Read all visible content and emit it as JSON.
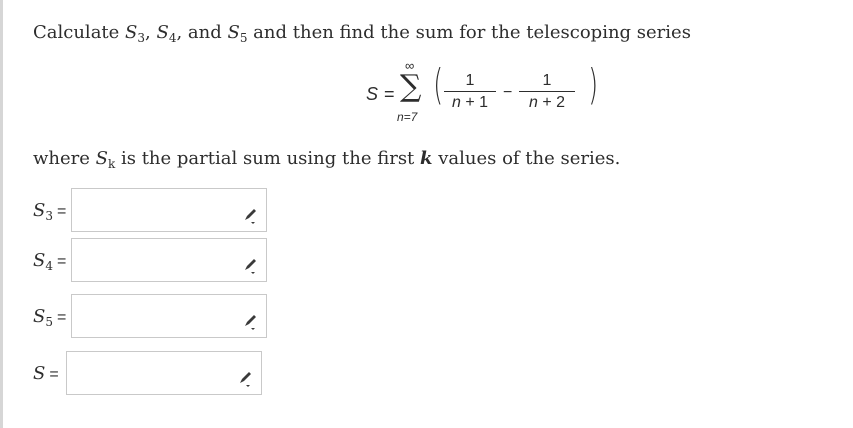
{
  "question": {
    "prefix": "Calculate ",
    "s3": "S",
    "s3_sub": "3",
    "comma1": ", ",
    "s4": "S",
    "s4_sub": "4",
    "comma2": ", and ",
    "s5": "S",
    "s5_sub": "5",
    "suffix": " and then find the sum for the telescoping series"
  },
  "series": {
    "lhs": "S",
    "equals": "=",
    "sigma": "∑",
    "upper": "∞",
    "lower": "n=7",
    "frac1_num": "1",
    "frac1_den_var": "n",
    "frac1_den_rest": " + 1",
    "minus": "−",
    "frac2_num": "1",
    "frac2_den_var": "n",
    "frac2_den_rest": " + 2",
    "lparen": "(",
    "rparen": ")"
  },
  "where": {
    "prefix": "where ",
    "var": "S",
    "sub": "k",
    "middle": " is the partial sum using the first ",
    "k": "k",
    "suffix": " values of the series."
  },
  "answers": [
    {
      "var": "S",
      "sub": "3",
      "eq": "=",
      "value": ""
    },
    {
      "var": "S",
      "sub": "4",
      "eq": "=",
      "value": ""
    },
    {
      "var": "S",
      "sub": "5",
      "eq": "=",
      "value": ""
    },
    {
      "var": "S",
      "sub": "",
      "eq": "=",
      "value": ""
    }
  ]
}
